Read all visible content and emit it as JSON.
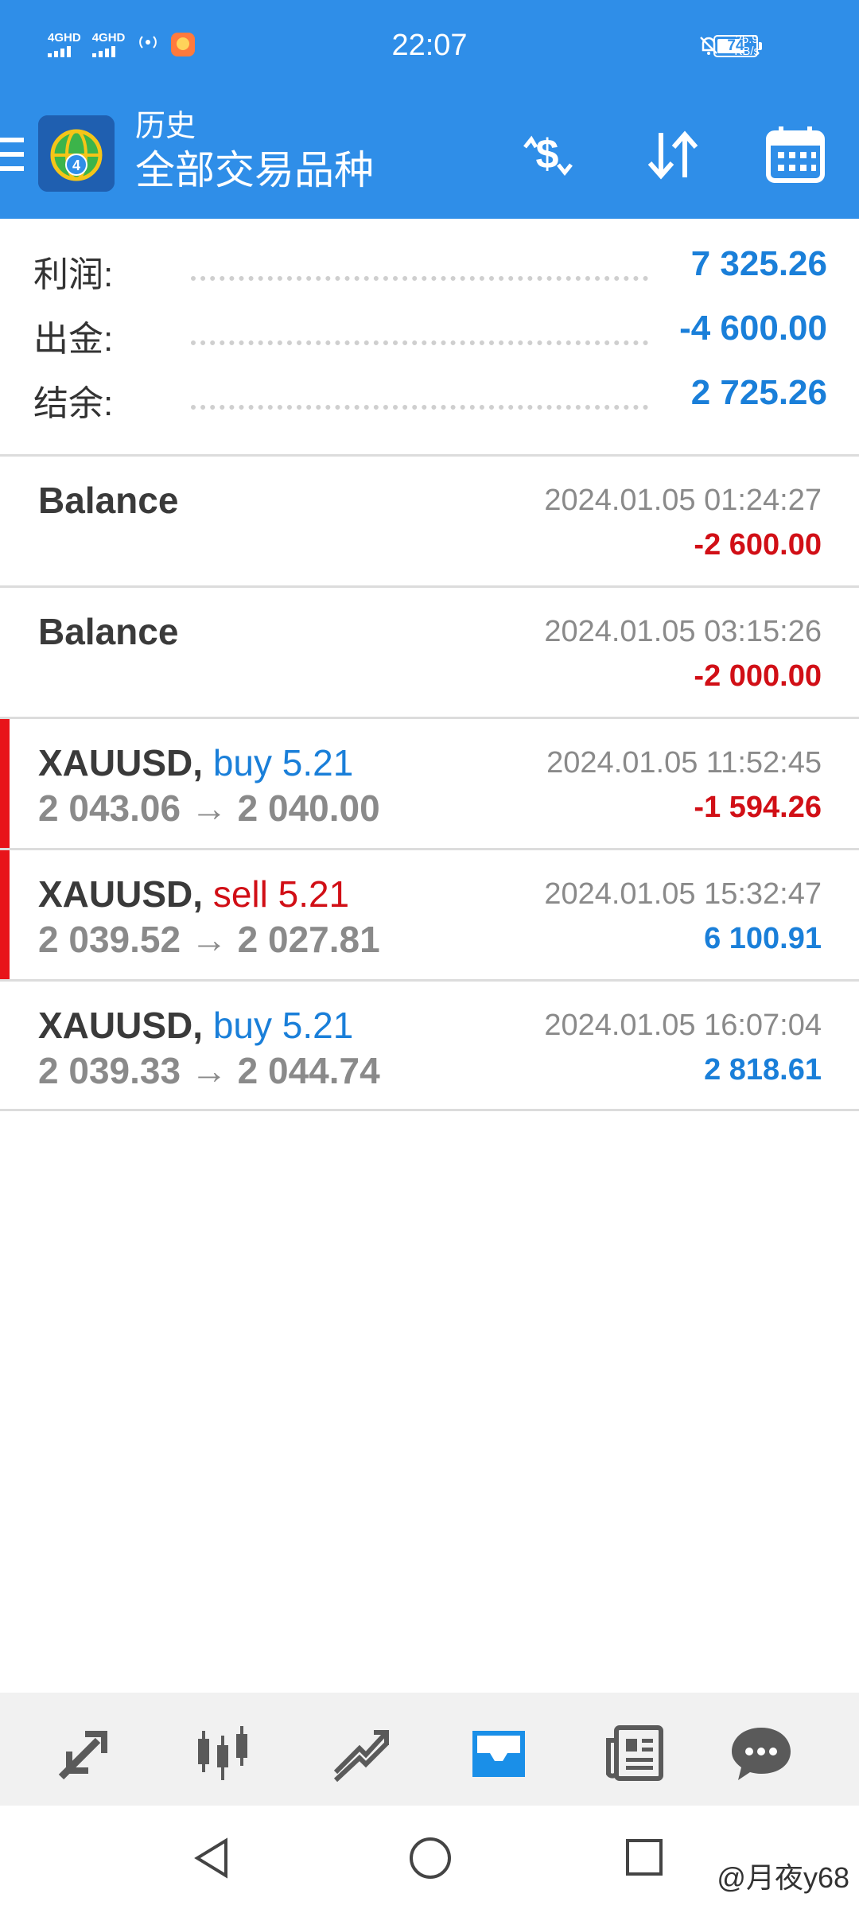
{
  "status_bar": {
    "signal1": "4GHD",
    "signal2": "4GHD",
    "time": "22:07",
    "net_speed_value": "25.9",
    "net_speed_unit": "KB/s",
    "battery": "74",
    "battery_level": 0.74
  },
  "toolbar": {
    "title": "历史",
    "subtitle": "全部交易品种",
    "icons": [
      "menu-icon",
      "app-logo",
      "dollar-swap-icon",
      "sort-icon",
      "calendar-icon"
    ]
  },
  "summary": [
    {
      "label": "利润:",
      "value": "7 325.26"
    },
    {
      "label": "出金:",
      "value": "-4 600.00"
    },
    {
      "label": "结余:",
      "value": "2 725.26"
    }
  ],
  "history": [
    {
      "title": "Balance",
      "symbol": "",
      "direction": "",
      "volume": "",
      "prices": "",
      "time": "2024.01.05 01:24:27",
      "profit": "-2 600.00",
      "profit_sign": "negative",
      "marker": false
    },
    {
      "title": "Balance",
      "symbol": "",
      "direction": "",
      "volume": "",
      "prices": "",
      "time": "2024.01.05 03:15:26",
      "profit": "-2 000.00",
      "profit_sign": "negative",
      "marker": false
    },
    {
      "title": "",
      "symbol": "XAUUSD,",
      "direction": "buy 5.21",
      "prices": "2 043.06 → 2 040.00",
      "time": "2024.01.05 11:52:45",
      "profit": "-1 594.26",
      "profit_sign": "negative",
      "marker": true
    },
    {
      "title": "",
      "symbol": "XAUUSD,",
      "direction": "sell 5.21",
      "prices": "2 039.52 → 2 027.81",
      "time": "2024.01.05 15:32:47",
      "profit": "6 100.91",
      "profit_sign": "positive",
      "marker": true
    },
    {
      "title": "",
      "symbol": "XAUUSD,",
      "direction": "buy 5.21",
      "prices": "2 039.33 → 2 044.74",
      "time": "2024.01.05 16:07:04",
      "profit": "2 818.61",
      "profit_sign": "positive",
      "marker": false
    }
  ],
  "bottom_nav": [
    "quotes-icon",
    "chart-icon",
    "trade-icon",
    "history-icon",
    "news-icon",
    "chat-icon"
  ],
  "bottom_nav_active": "history-icon",
  "system_nav": [
    "back-icon",
    "home-icon",
    "recents-icon"
  ],
  "watermark": "@月夜y68",
  "colors": {
    "header": "#2f8ee8",
    "positive": "#1a7fd9",
    "negative": "#d10f16",
    "marker": "#e8141a"
  }
}
